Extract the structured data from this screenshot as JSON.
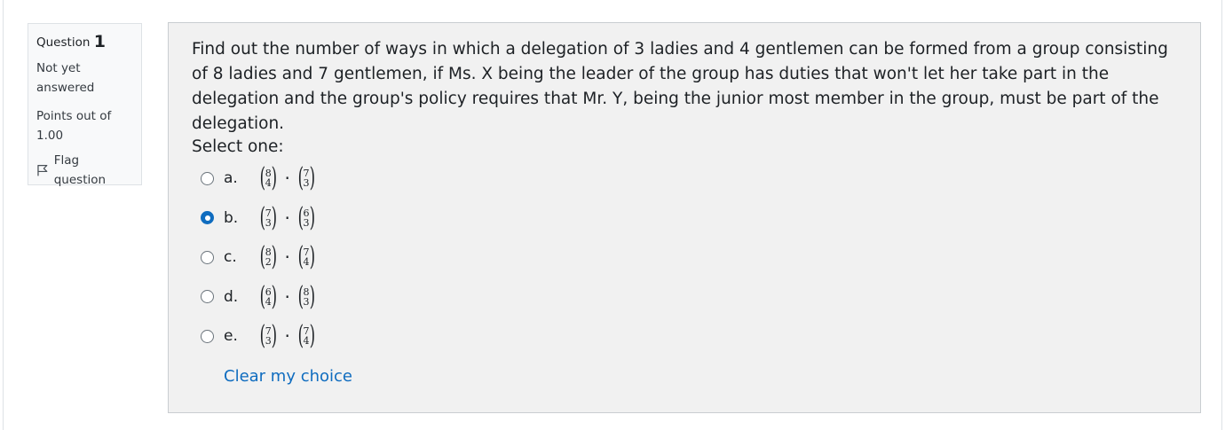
{
  "info": {
    "question_word": "Question",
    "question_number": "1",
    "state": "Not yet answered",
    "grade": "Points out of 1.00",
    "flag_label": "Flag question"
  },
  "question": {
    "text": "Find out the number of ways in which a delegation of 3 ladies and 4 gentlemen can be formed from a group consisting of 8 ladies and 7 gentlemen, if Ms. X being the leader of the group has duties that won't let her take part in the delegation and the group's policy requires that Mr. Y, being the junior most member in the group, must be part of the delegation.",
    "prompt": "Select one:",
    "options": [
      {
        "label": "a.",
        "binom1": {
          "n": "8",
          "k": "4"
        },
        "binom2": {
          "n": "7",
          "k": "3"
        },
        "dot": "·",
        "selected": false
      },
      {
        "label": "b.",
        "binom1": {
          "n": "7",
          "k": "3"
        },
        "binom2": {
          "n": "6",
          "k": "3"
        },
        "dot": "·",
        "selected": true
      },
      {
        "label": "c.",
        "binom1": {
          "n": "8",
          "k": "2"
        },
        "binom2": {
          "n": "7",
          "k": "4"
        },
        "dot": "·",
        "selected": false
      },
      {
        "label": "d.",
        "binom1": {
          "n": "6",
          "k": "4"
        },
        "binom2": {
          "n": "8",
          "k": "3"
        },
        "dot": "·",
        "selected": false
      },
      {
        "label": "e.",
        "binom1": {
          "n": "7",
          "k": "3"
        },
        "binom2": {
          "n": "7",
          "k": "4"
        },
        "dot": "·",
        "selected": false
      }
    ],
    "clear_label": "Clear my choice"
  },
  "icons": {
    "flag": "flag-icon",
    "radio": "radio-button"
  },
  "colors": {
    "accent": "#0f6cbf",
    "panel_bg": "#f1f1f1",
    "info_bg": "#f8f9fa"
  }
}
